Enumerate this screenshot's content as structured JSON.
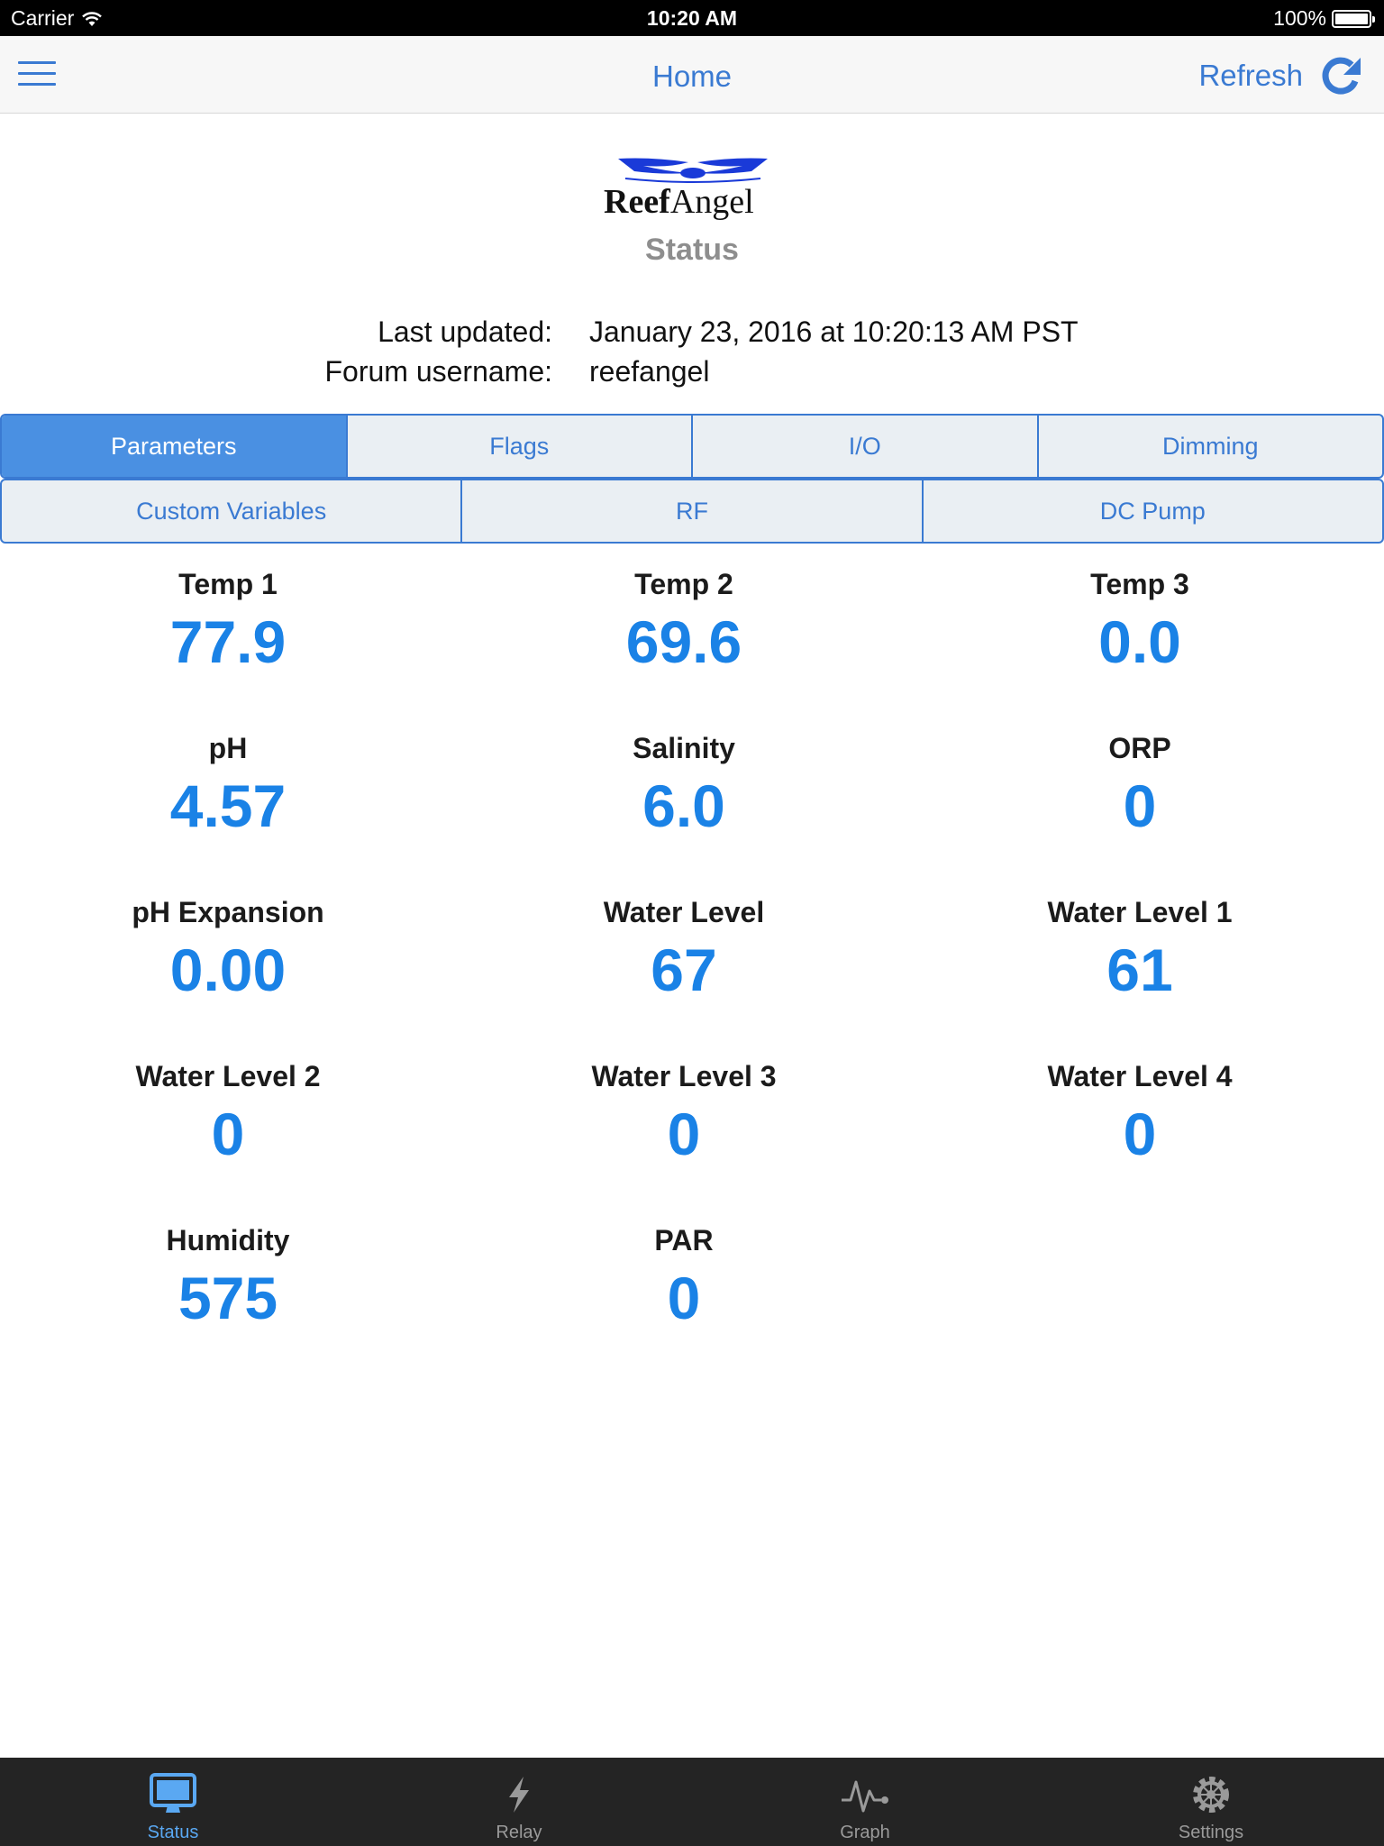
{
  "status_bar": {
    "carrier": "Carrier",
    "time": "10:20 AM",
    "battery": "100%"
  },
  "nav": {
    "title": "Home",
    "refresh_label": "Refresh",
    "menu_icon": "hamburger-menu-icon",
    "refresh_icon": "refresh-icon"
  },
  "logo": {
    "brand_bold": "Reef",
    "brand_regular": "Angel"
  },
  "page_subtitle": "Status",
  "info": {
    "last_updated_label": "Last updated:",
    "last_updated_value": "January 23, 2016 at 10:20:13 AM PST",
    "username_label": "Forum username:",
    "username_value": "reefangel"
  },
  "segments_row1": [
    "Parameters",
    "Flags",
    "I/O",
    "Dimming"
  ],
  "segments_row2": [
    "Custom Variables",
    "RF",
    "DC Pump"
  ],
  "selected_segment": "Parameters",
  "parameters": [
    {
      "name": "Temp 1",
      "value": "77.9"
    },
    {
      "name": "Temp 2",
      "value": "69.6"
    },
    {
      "name": "Temp 3",
      "value": "0.0"
    },
    {
      "name": "pH",
      "value": "4.57"
    },
    {
      "name": "Salinity",
      "value": "6.0"
    },
    {
      "name": "ORP",
      "value": "0"
    },
    {
      "name": "pH Expansion",
      "value": "0.00"
    },
    {
      "name": "Water Level",
      "value": "67"
    },
    {
      "name": "Water Level 1",
      "value": "61"
    },
    {
      "name": "Water Level 2",
      "value": "0"
    },
    {
      "name": "Water Level 3",
      "value": "0"
    },
    {
      "name": "Water Level 4",
      "value": "0"
    },
    {
      "name": "Humidity",
      "value": "575"
    },
    {
      "name": "PAR",
      "value": "0"
    }
  ],
  "tabs": [
    {
      "label": "Status",
      "icon": "monitor-icon",
      "active": true
    },
    {
      "label": "Relay",
      "icon": "lightning-bolt-icon",
      "active": false
    },
    {
      "label": "Graph",
      "icon": "pulse-graph-icon",
      "active": false
    },
    {
      "label": "Settings",
      "icon": "gear-icon",
      "active": false
    }
  ],
  "colors": {
    "accent": "#3a7ad2",
    "value_blue": "#1a82e6",
    "active_segment": "#4a90e2",
    "tab_bar": "#242424",
    "tab_active": "#5aa8f2"
  }
}
